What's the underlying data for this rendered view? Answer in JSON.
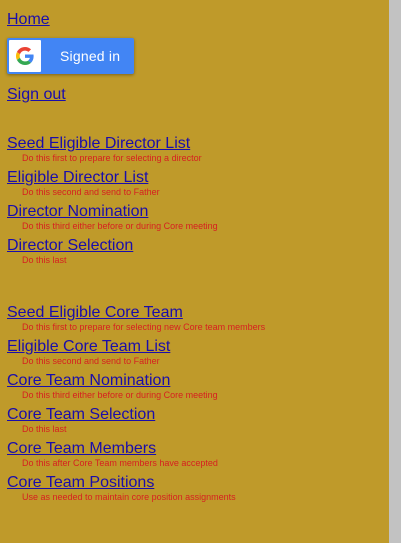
{
  "nav": {
    "home": "Home",
    "signin_label": "Signed in",
    "signout": "Sign out"
  },
  "director_section": [
    {
      "label": "Seed Eligible Director List",
      "desc": "Do this first to prepare for selecting a director"
    },
    {
      "label": "Eligible Director List",
      "desc": "Do this second and send to Father"
    },
    {
      "label": "Director Nomination",
      "desc": "Do this third either before or during Core meeting"
    },
    {
      "label": "Director Selection",
      "desc": "Do this last"
    }
  ],
  "core_section": [
    {
      "label": "Seed Eligible Core Team",
      "desc": "Do this first to prepare for selecting new Core team members"
    },
    {
      "label": "Eligible Core Team List",
      "desc": "Do this second and send to Father"
    },
    {
      "label": "Core Team Nomination",
      "desc": "Do this third either before or during Core meeting"
    },
    {
      "label": "Core Team Selection",
      "desc": "Do this last"
    },
    {
      "label": "Core Team Members",
      "desc": "Do this after Core Team members have accepted"
    },
    {
      "label": "Core Team Positions",
      "desc": "Use as needed to maintain core position assignments"
    }
  ],
  "colors": {
    "background": "#bf9a2a",
    "link": "#1a0dab",
    "description": "#d62020",
    "google_button": "#4285f4",
    "scrollbar": "#c2c2c2"
  },
  "icons": {
    "google": "google-g-icon"
  }
}
